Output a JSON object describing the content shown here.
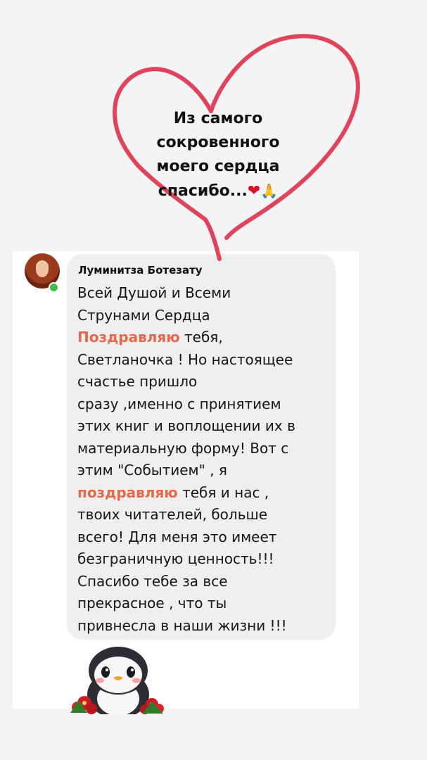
{
  "story": {
    "caption_lines": [
      "Из самого",
      "сокровенного",
      "моего сердца",
      "спасибо..."
    ],
    "emoji_heart": "❤",
    "emoji_hands": "🙏",
    "heart_color": "#e0445a"
  },
  "comment": {
    "author": "Луминитза Ботезату",
    "online": true,
    "lines": [
      {
        "pre": "Всей Душой и Всеми",
        "hl": "",
        "post": ""
      },
      {
        "pre": "Струнами Сердца",
        "hl": "",
        "post": ""
      },
      {
        "pre": "",
        "hl": "Поздравляю",
        "post": " тебя,"
      },
      {
        "pre": "Светланочка ! Но настоящее",
        "hl": "",
        "post": ""
      },
      {
        "pre": "счастье пришло",
        "hl": "",
        "post": ""
      },
      {
        "pre": "сразу ,именно с принятием",
        "hl": "",
        "post": ""
      },
      {
        "pre": "этих книг и  воплощении их в",
        "hl": "",
        "post": ""
      },
      {
        "pre": "материальную форму!  Вот  с",
        "hl": "",
        "post": ""
      },
      {
        "pre": "этим \"Событием\" , я",
        "hl": "",
        "post": ""
      },
      {
        "pre": "",
        "hl": "поздравляю",
        "post": " тебя и нас ,"
      },
      {
        "pre": "твоих читателей, больше",
        "hl": "",
        "post": ""
      },
      {
        "pre": "всего!  Для меня это имеет",
        "hl": "",
        "post": ""
      },
      {
        "pre": "безграничную ценность!!!",
        "hl": "",
        "post": ""
      },
      {
        "pre": "Спасибо тебе за все",
        "hl": "",
        "post": ""
      },
      {
        "pre": "прекрасное , что ты",
        "hl": "",
        "post": ""
      },
      {
        "pre": "привнесла в наши жизни !!!",
        "hl": "",
        "post": ""
      }
    ],
    "highlight_color": "#e36a4a",
    "sticker": "penguin-with-flowers-sticker"
  }
}
